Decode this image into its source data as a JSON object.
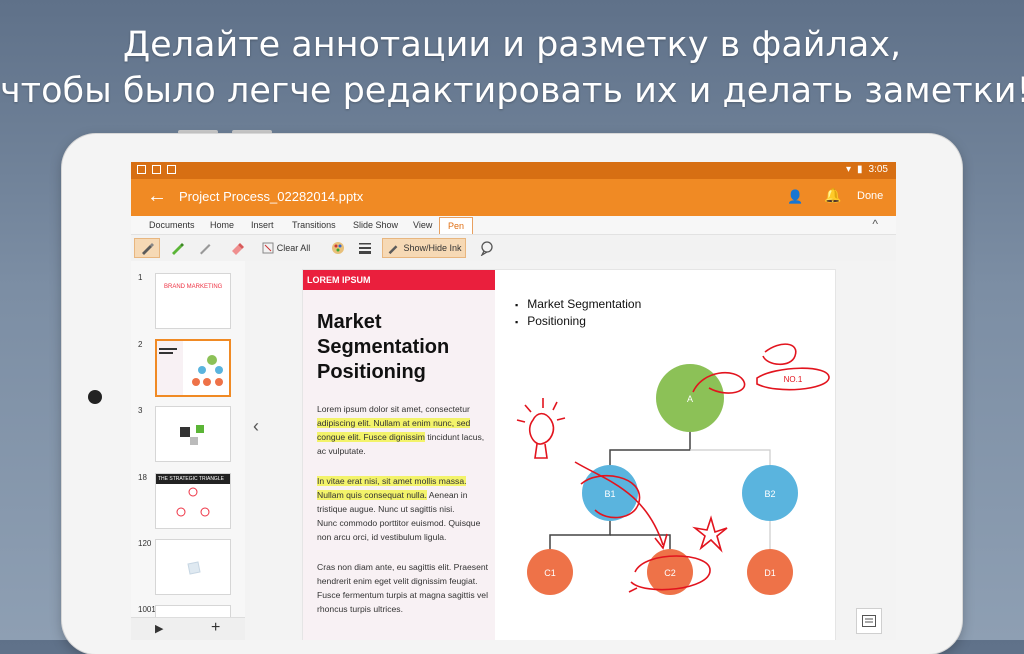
{
  "headline": {
    "line1": "Делайте аннотации и разметку в файлах,",
    "line2": "чтобы было легче редактировать их и делать заметки!"
  },
  "status": {
    "time": "3:05"
  },
  "appbar": {
    "title": "Project Process_02282014.pptx",
    "done": "Done",
    "accent": "#f08a24",
    "status_color": "#d76f13"
  },
  "tabs": [
    {
      "label": "Documents"
    },
    {
      "label": "Home"
    },
    {
      "label": "Insert"
    },
    {
      "label": "Transitions"
    },
    {
      "label": "Slide Show"
    },
    {
      "label": "View"
    },
    {
      "label": "Pen"
    }
  ],
  "active_tab": "Pen",
  "toolbar": {
    "clear_all": "Clear All",
    "show_hide_ink": "Show/Hide Ink",
    "icons": [
      "pen-icon",
      "highlighter-icon",
      "pencil-icon",
      "eraser-icon",
      "clear-all-icon",
      "color-palette-icon",
      "line-thickness-icon",
      "show-hide-ink-icon",
      "comment-icon"
    ]
  },
  "thumbnails": [
    {
      "num": "1",
      "title": "BRAND MARKETING"
    },
    {
      "num": "2",
      "title": ""
    },
    {
      "num": "3",
      "title": ""
    },
    {
      "num": "18",
      "title": "THE STRATEGIC TRIANGLE"
    },
    {
      "num": "120",
      "title": ""
    },
    {
      "num": "1001",
      "title": ""
    }
  ],
  "slide": {
    "tag": "LOREM IPSUM",
    "heading_l1": "Market",
    "heading_l2": "Segmentation",
    "heading_l3": "Positioning",
    "p1_a": "Lorem ipsum dolor sit amet, consectetur",
    "p1_b": "adipiscing elit. Nullam at enim nunc, sed",
    "p1_c": "congue elit. Fusce dignissim",
    "p1_c2": " tincidunt lacus,",
    "p1_d": "ac vulputate.",
    "p2_a": "In vitae erat nisi, sit amet mollis massa.",
    "p2_b": "Nullam quis consequat nulla.",
    "p2_b2": " Aenean in",
    "p2_c": "tristique augue. Nunc ut sagittis nisi.",
    "p2_d": "Nunc commodo porttitor euismod. Quisque",
    "p2_e": "non arcu orci, id vestibulum ligula.",
    "p3_a": "Cras non diam ante, eu sagittis elit. Praesent",
    "p3_b": "hendrerit enim eget velit dignissim feugiat.",
    "p3_c": "Fusce fermentum turpis at magna sagittis vel",
    "p3_d": "rhoncus turpis ultrices.",
    "bullet1": "Market Segmentation",
    "bullet2": "Positioning",
    "nodes": {
      "a": "A",
      "b1": "B1",
      "b2": "B2",
      "c1": "C1",
      "c2": "C2",
      "d1": "D1"
    },
    "ink_note": "NO.1",
    "colors": {
      "green": "#8cc157",
      "blue": "#5ab4de",
      "orange": "#ee7248",
      "ink": "#e2141e"
    }
  }
}
